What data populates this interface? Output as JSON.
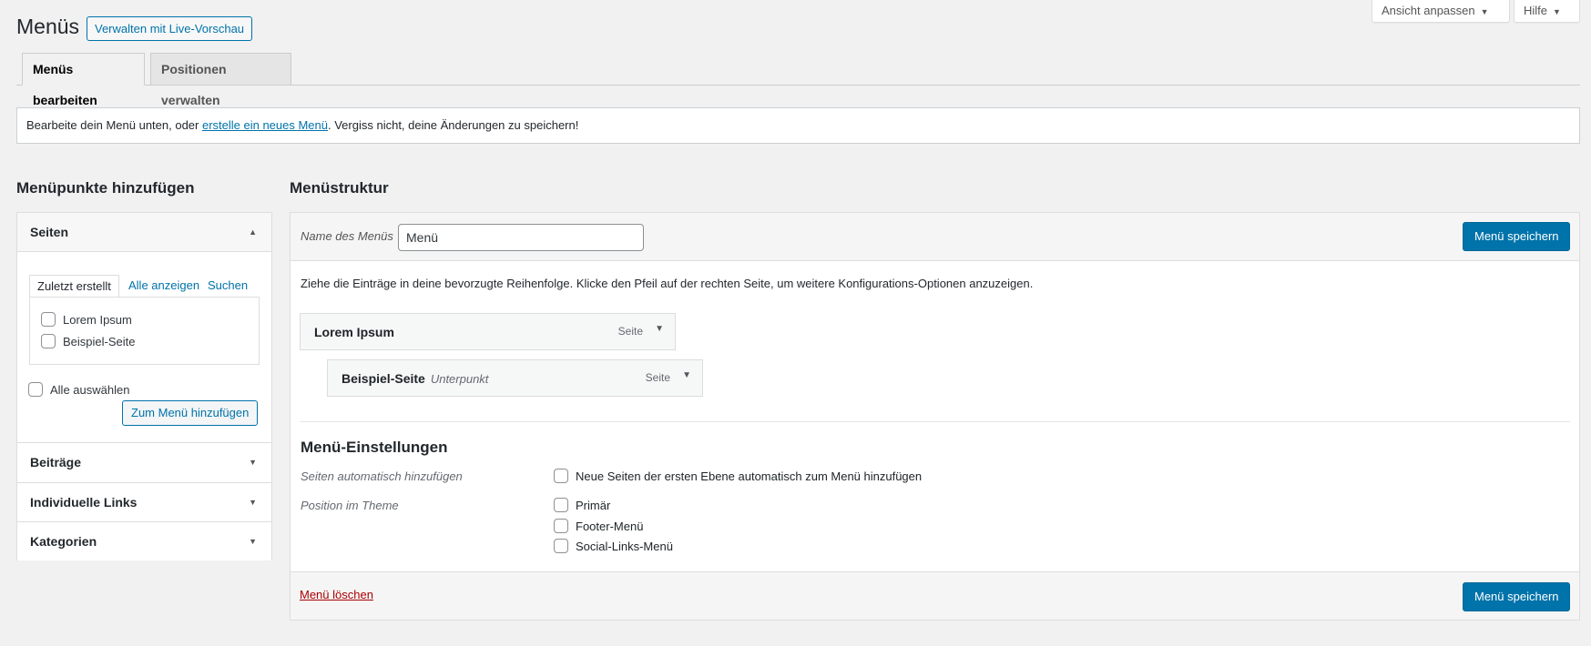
{
  "header": {
    "title": "Menüs",
    "live_preview_button": "Verwalten mit Live-Vorschau",
    "screen_options": "Ansicht anpassen",
    "help": "Hilfe"
  },
  "tabs": [
    "Menüs bearbeiten",
    "Positionen verwalten"
  ],
  "notice": {
    "before": "Bearbeite dein Menü unten, oder ",
    "link": "erstelle ein neues Menü",
    "after": ". Vergiss nicht, deine Änderungen zu speichern!"
  },
  "left": {
    "title": "Menüpunkte hinzufügen",
    "pages": {
      "header": "Seiten",
      "tabs": [
        "Zuletzt erstellt",
        "Alle anzeigen",
        "Suchen"
      ],
      "items": [
        "Lorem Ipsum",
        "Beispiel-Seite"
      ],
      "select_all": "Alle auswählen",
      "add_button": "Zum Menü hinzufügen"
    },
    "sections": [
      "Beiträge",
      "Individuelle Links",
      "Kategorien"
    ]
  },
  "right": {
    "title": "Menüstruktur",
    "name_label": "Name des Menüs",
    "name_value": "Menü",
    "save_button": "Menü speichern",
    "drag_hint": "Ziehe die Einträge in deine bevorzugte Reihenfolge. Klicke den Pfeil auf der rechten Seite, um weitere Konfigurations-Optionen anzuzeigen.",
    "menu_items": [
      {
        "title": "Lorem Ipsum",
        "subtitle": "",
        "type": "Seite"
      },
      {
        "title": "Beispiel-Seite",
        "subtitle": "Unterpunkt",
        "type": "Seite"
      }
    ],
    "settings": {
      "title": "Menü-Einstellungen",
      "auto_add_label": "Seiten automatisch hinzufügen",
      "auto_add_option": "Neue Seiten der ersten Ebene automatisch zum Menü hinzufügen",
      "position_label": "Position im Theme",
      "positions": [
        "Primär",
        "Footer-Menü",
        "Social-Links-Menü"
      ]
    },
    "delete_link": "Menü löschen"
  },
  "colors": {
    "accent": "#0073aa",
    "delete": "#aa0000",
    "background": "#f1f1f1"
  }
}
